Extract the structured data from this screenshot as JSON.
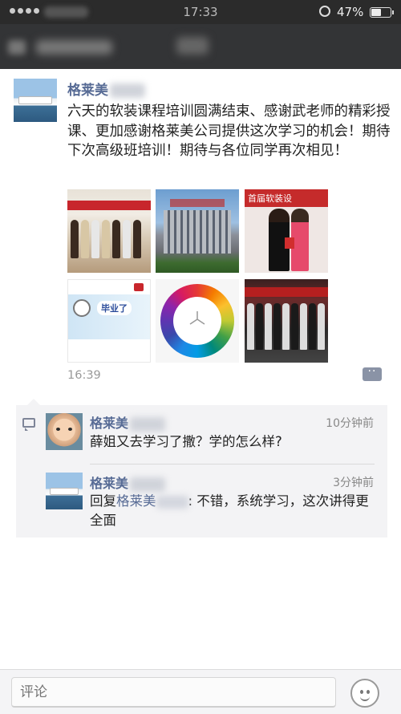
{
  "status_bar": {
    "time": "17:33",
    "battery_percent": "47%",
    "battery_level": 0.47
  },
  "post": {
    "author_name": "格莱美",
    "text": "六天的软装课程培训圆满结束、感谢武老师的精彩授课、更加感谢格莱美公司提供这次学习的机会！期待下次高级班培训！期待与各位同学再次相见！",
    "photos": [
      {
        "name": "group-photo-1"
      },
      {
        "name": "building-photo"
      },
      {
        "name": "certificate-photo"
      },
      {
        "name": "graduation-slide-photo",
        "caption": "毕业了"
      },
      {
        "name": "color-wheel-photo"
      },
      {
        "name": "group-photo-2"
      }
    ],
    "photo3_banner": "首届软装设",
    "time": "16:39",
    "comment_button_icon": "comment-more-icon"
  },
  "comments": [
    {
      "author": "格莱美",
      "time": "10分钟前",
      "text": "薛姐又去学习了撒？学的怎么样?"
    },
    {
      "author": "格莱美",
      "time": "3分钟前",
      "reply_prefix": "回复",
      "reply_to": "格莱美",
      "text": ": 不错，系统学习，这次讲得更全面"
    }
  ],
  "input_bar": {
    "placeholder": "评论",
    "emoji_icon": "emoji-smile-icon"
  },
  "colors": {
    "link": "#576b95",
    "navbar": "#333436",
    "comment_bg": "#f3f3f5"
  }
}
